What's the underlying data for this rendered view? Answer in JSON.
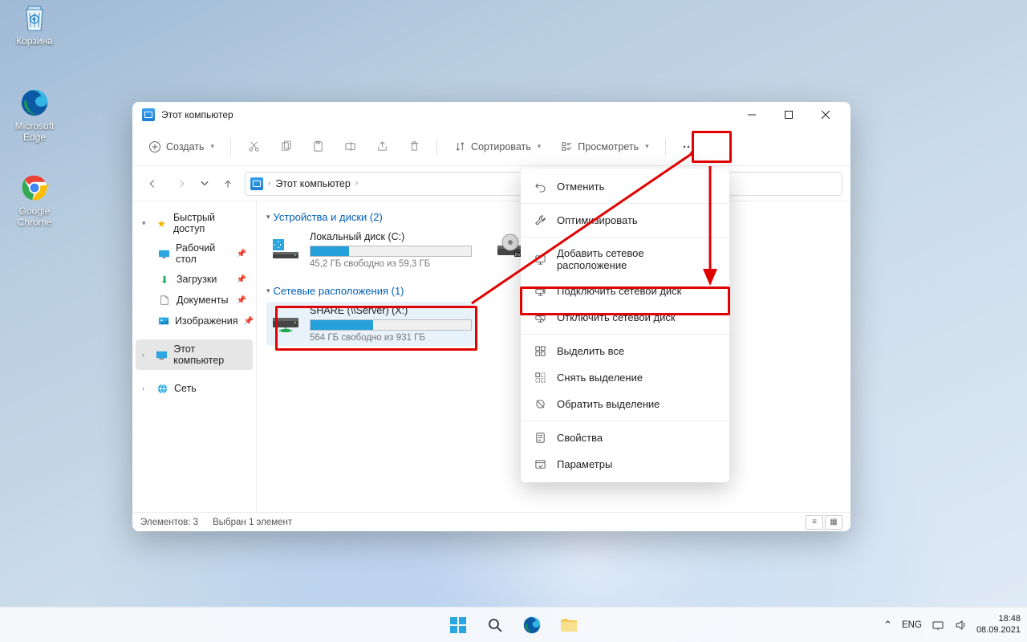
{
  "desktop": {
    "recycle": "Корзина",
    "edge": "Microsoft Edge",
    "chrome": "Google Chrome"
  },
  "window": {
    "title": "Этот компьютер",
    "toolbar": {
      "new": "Создать",
      "sort": "Сортировать",
      "view": "Просмотреть"
    },
    "breadcrumb": "Этот компьютер",
    "sidebar": {
      "quick": "Быстрый доступ",
      "desktop": "Рабочий стол",
      "downloads": "Загрузки",
      "documents": "Документы",
      "pictures": "Изображения",
      "thispc": "Этот компьютер",
      "network": "Сеть"
    },
    "groups": {
      "devices": "Устройства и диски (2)",
      "network": "Сетевые расположения (1)"
    },
    "drives": {
      "local": {
        "name": "Локальный диск (C:)",
        "free": "45,2 ГБ свободно из 59,3 ГБ",
        "fill_pct": 24
      },
      "net": {
        "name": "SHARE (\\\\Server) (X:)",
        "free": "564 ГБ свободно из 931 ГБ",
        "fill_pct": 39
      }
    },
    "status": {
      "items": "Элементов: 3",
      "selected": "Выбран 1 элемент"
    }
  },
  "menu": {
    "undo": "Отменить",
    "optimize": "Оптимизировать",
    "add_net_loc": "Добавить сетевое расположение",
    "map_drive": "Подключить сетевой диск",
    "unmap_drive": "Отключить сетевой диск",
    "select_all": "Выделить все",
    "select_none": "Снять выделение",
    "invert_sel": "Обратить выделение",
    "properties": "Свойства",
    "options": "Параметры"
  },
  "taskbar": {
    "lang": "ENG",
    "time": "18:48",
    "date": "08.09.2021"
  }
}
